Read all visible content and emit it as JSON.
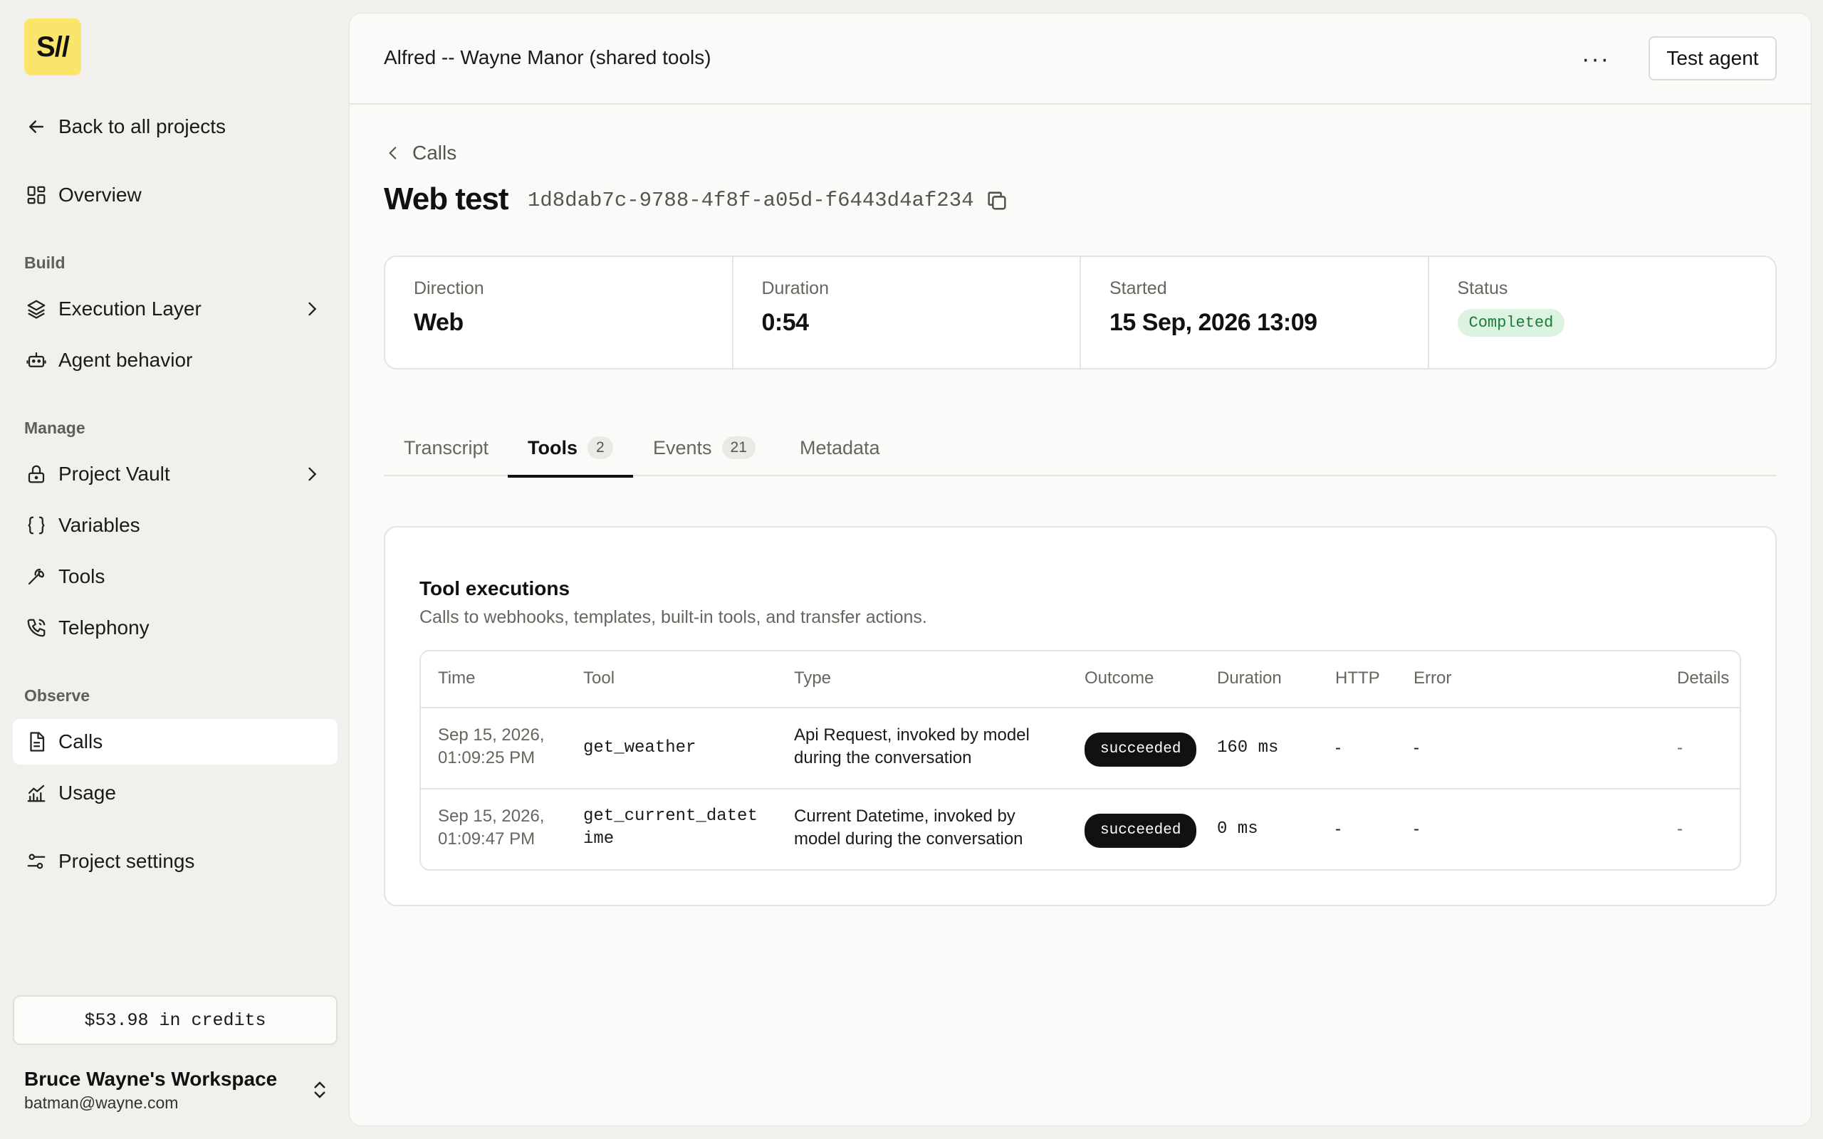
{
  "sidebar": {
    "logo_text": "S//",
    "back_label": "Back to all projects",
    "overview_label": "Overview",
    "sections": {
      "build": "Build",
      "manage": "Manage",
      "observe": "Observe"
    },
    "items": {
      "execution_layer": "Execution Layer",
      "agent_behavior": "Agent behavior",
      "project_vault": "Project Vault",
      "variables": "Variables",
      "tools": "Tools",
      "telephony": "Telephony",
      "calls": "Calls",
      "usage": "Usage",
      "project_settings": "Project settings"
    },
    "credits": "$53.98 in credits",
    "workspace": {
      "name": "Bruce Wayne's Workspace",
      "email": "batman@wayne.com"
    }
  },
  "header": {
    "project_title": "Alfred -- Wayne Manor (shared tools)",
    "more_label": "···",
    "test_agent_label": "Test agent"
  },
  "page": {
    "breadcrumb": "Calls",
    "title": "Web test",
    "call_id": "1d8dab7c-9788-4f8f-a05d-f6443d4af234"
  },
  "stats": {
    "direction_label": "Direction",
    "direction_value": "Web",
    "duration_label": "Duration",
    "duration_value": "0:54",
    "started_label": "Started",
    "started_value": "15 Sep, 2026 13:09",
    "status_label": "Status",
    "status_value": "Completed"
  },
  "tabs": [
    {
      "label": "Transcript",
      "count": ""
    },
    {
      "label": "Tools",
      "count": "2"
    },
    {
      "label": "Events",
      "count": "21"
    },
    {
      "label": "Metadata",
      "count": ""
    }
  ],
  "tool_executions": {
    "title": "Tool executions",
    "subtitle": "Calls to webhooks, templates, built-in tools, and transfer actions.",
    "columns": [
      "Time",
      "Tool",
      "Type",
      "Outcome",
      "Duration",
      "HTTP",
      "Error",
      "Details"
    ],
    "rows": [
      {
        "time_line1": "Sep 15, 2026,",
        "time_line2": "01:09:25 PM",
        "tool_line1": "get_weather",
        "tool_line2": "",
        "type_line1": "Api Request, invoked by model",
        "type_line2": "during the conversation",
        "outcome": "succeeded",
        "duration": "160 ms",
        "http": "-",
        "error": "-",
        "details": "-"
      },
      {
        "time_line1": "Sep 15, 2026,",
        "time_line2": "01:09:47 PM",
        "tool_line1": "get_current_datet",
        "tool_line2": "ime",
        "type_line1": "Current Datetime, invoked by",
        "type_line2": "model during the conversation",
        "outcome": "succeeded",
        "duration": "0 ms",
        "http": "-",
        "error": "-",
        "details": "-"
      }
    ]
  },
  "colors": {
    "brand_yellow": "#fbe46a",
    "status_green_bg": "#dcf3e1",
    "status_green_text": "#1f7a3a",
    "pill_dark": "#111111"
  }
}
